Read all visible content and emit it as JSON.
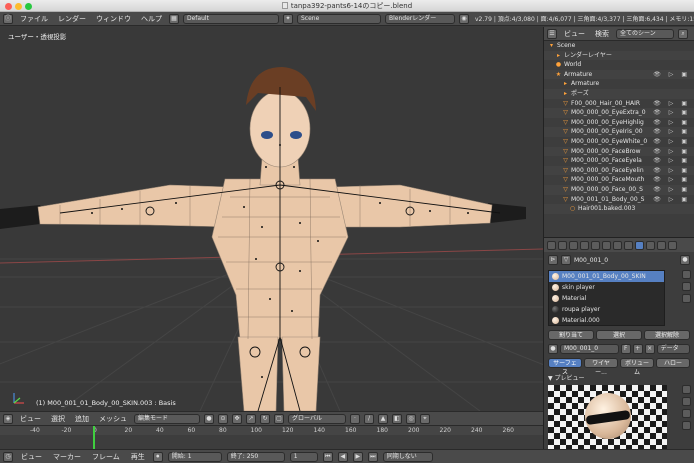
{
  "window": {
    "title": "tanpa392-pants6-14のコピー.blend"
  },
  "info_header": {
    "menus": [
      "ファイル",
      "レンダー",
      "ウィンドウ",
      "ヘルプ"
    ],
    "layout": "Default",
    "scene": "Scene",
    "engine": "Blenderレンダー",
    "stats": "v2.79 | 頂点:4/3,080 | 面:4/6,077 | 三角面:4/3,377 | 三角面:6,434 | メモリ:159.30M"
  },
  "viewport": {
    "view_label": "ユーザー・透視投影",
    "status": "(1) M00_001_01_Body_00_SKIN.003 : Basis",
    "header": {
      "menus": [
        "ビュー",
        "選択",
        "追加",
        "メッシュ"
      ],
      "mode": "編集モード",
      "orientation": "グローバル"
    }
  },
  "timeline": {
    "ticks": [
      "-40",
      "-20",
      "0",
      "20",
      "40",
      "60",
      "80",
      "100",
      "120",
      "140",
      "160",
      "180",
      "200",
      "220",
      "240",
      "260"
    ],
    "current_frame": 1,
    "header": {
      "menus": [
        "ビュー",
        "マーカー",
        "フレーム",
        "再生"
      ],
      "start_label": "開始:",
      "start": "1",
      "end_label": "終了:",
      "end": "250",
      "current": "1",
      "sync": "同期しない"
    }
  },
  "outliner": {
    "header": {
      "menus": [
        "ビュー",
        "検索"
      ],
      "filter": "全てのシーン"
    },
    "rows": [
      {
        "name": "Scene",
        "glyph": "▾",
        "indent": 0
      },
      {
        "name": "レンダーレイヤー",
        "glyph": "▸",
        "indent": 1
      },
      {
        "name": "World",
        "glyph": "●",
        "indent": 1
      },
      {
        "name": "Armature",
        "glyph": "★",
        "indent": 1,
        "vis": "👁 ▷ ▣"
      },
      {
        "name": "Armature",
        "glyph": "▸",
        "indent": 2
      },
      {
        "name": "ポーズ",
        "glyph": "▸",
        "indent": 2
      },
      {
        "name": "F00_000_Hair_00_HAIR",
        "glyph": "▽",
        "indent": 2,
        "vis": "👁 ▷ ▣"
      },
      {
        "name": "M00_000_00_EyeExtra_0",
        "glyph": "▽",
        "indent": 2,
        "vis": "👁 ▷ ▣"
      },
      {
        "name": "M00_000_00_EyeHighlig",
        "glyph": "▽",
        "indent": 2,
        "vis": "👁 ▷ ▣"
      },
      {
        "name": "M00_000_00_EyeIris_00",
        "glyph": "▽",
        "indent": 2,
        "vis": "👁 ▷ ▣"
      },
      {
        "name": "M00_000_00_EyeWhite_0",
        "glyph": "▽",
        "indent": 2,
        "vis": "👁 ▷ ▣"
      },
      {
        "name": "M00_000_00_FaceBrow",
        "glyph": "▽",
        "indent": 2,
        "vis": "👁 ▷ ▣"
      },
      {
        "name": "M00_000_00_FaceEyela",
        "glyph": "▽",
        "indent": 2,
        "vis": "👁 ▷ ▣"
      },
      {
        "name": "M00_000_00_FaceEyelin",
        "glyph": "▽",
        "indent": 2,
        "vis": "👁 ▷ ▣"
      },
      {
        "name": "M00_000_00_FaceMouth",
        "glyph": "▽",
        "indent": 2,
        "vis": "👁 ▷ ▣"
      },
      {
        "name": "M00_000_00_Face_00_S",
        "glyph": "▽",
        "indent": 2,
        "vis": "👁 ▷ ▣"
      },
      {
        "name": "M00_001_01_Body_00_S",
        "glyph": "▽",
        "indent": 2,
        "vis": "👁 ▷ ▣"
      },
      {
        "name": "Hair001.baked.003",
        "glyph": "○",
        "indent": 3
      }
    ]
  },
  "properties": {
    "object_name": "M00_001_0",
    "material_name": "M00_001_0",
    "slots": [
      {
        "name": "M00_001_01_Body_00_SKIN",
        "selected": true
      },
      {
        "name": "skin player",
        "selected": false
      },
      {
        "name": "Material",
        "selected": false
      },
      {
        "name": "roupa player",
        "selected": false
      },
      {
        "name": "Material.000",
        "selected": false
      }
    ],
    "buttons": {
      "assign": "割り当て",
      "select": "選択",
      "deselect": "選択解除"
    },
    "data_label": "データ",
    "subtabs": [
      "サーフェス",
      "ワイヤー...",
      "ボリューム",
      "ハロー"
    ],
    "preview_label": "プレビュー"
  },
  "colors": {
    "accent": "#5680c2",
    "skin": "#e9c7a8",
    "outliner_icon": "#ffa23a",
    "playhead": "#3fcf3f",
    "background": "#393939"
  }
}
